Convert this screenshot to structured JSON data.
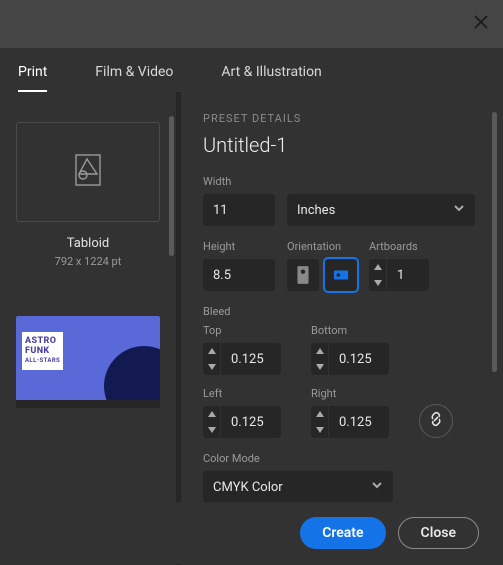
{
  "tabs": {
    "print": "Print",
    "film": "Film & Video",
    "art": "Art & Illustration"
  },
  "preset": {
    "name": "Tabloid",
    "size": "792 x 1224 pt"
  },
  "details": {
    "header": "PRESET DETAILS",
    "docName": "Untitled-1",
    "labels": {
      "width": "Width",
      "height": "Height",
      "orientation": "Orientation",
      "artboards": "Artboards",
      "bleed": "Bleed",
      "top": "Top",
      "bottom": "Bottom",
      "left": "Left",
      "right": "Right",
      "colorMode": "Color Mode"
    },
    "width": "11",
    "units": "Inches",
    "height": "8.5",
    "artboards": "1",
    "bleed": {
      "top": "0.125",
      "bottom": "0.125",
      "left": "0.125",
      "right": "0.125"
    },
    "colorMode": "CMYK Color"
  },
  "thumb": {
    "line1": "ASTRO",
    "line2": "FUNK",
    "line3": "ALL-STARS"
  },
  "buttons": {
    "create": "Create",
    "close": "Close"
  }
}
